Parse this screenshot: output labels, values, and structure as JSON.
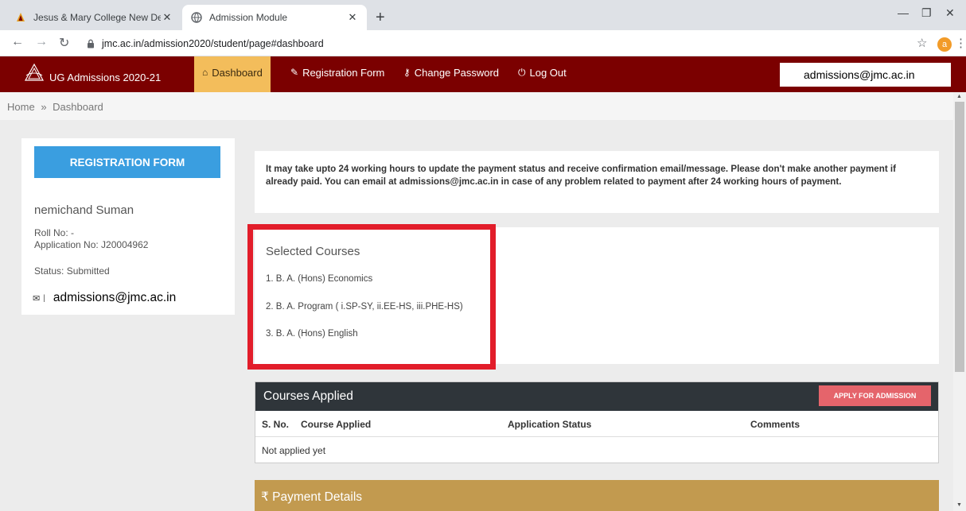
{
  "browser": {
    "tabs": [
      {
        "title": "Jesus & Mary College New Delhi",
        "active": false
      },
      {
        "title": "Admission Module",
        "active": true
      }
    ],
    "new_tab": "+",
    "url": "jmc.ac.in/admission2020/student/page#dashboard",
    "profile_initial": "a"
  },
  "header": {
    "brand": "UG Admissions 2020-21",
    "nav": [
      {
        "label": "Dashboard",
        "icon": "home-icon",
        "glyph": "⌂",
        "active": true
      },
      {
        "label": "Registration Form",
        "icon": "edit-icon",
        "glyph": "✎",
        "active": false
      },
      {
        "label": "Change Password",
        "icon": "key-icon",
        "glyph": "⚷",
        "active": false
      },
      {
        "label": "Log Out",
        "icon": "power-icon",
        "glyph": "⏻",
        "active": false
      }
    ],
    "email_overlay": "admissions@jmc.ac.in"
  },
  "breadcrumb": {
    "home": "Home",
    "sep": "»",
    "current": "Dashboard"
  },
  "sidebar": {
    "button": "REGISTRATION FORM",
    "name": "nemichand Suman",
    "roll": "Roll No: -",
    "application": "Application No: J20004962",
    "status": "Status: Submitted",
    "email": "admissions@jmc.ac.in"
  },
  "notice": "It may take upto 24 working hours to update the payment status and receive confirmation email/message. Please don't make another payment if already paid. You can email at admissions@jmc.ac.in in case of any problem related to payment after 24 working hours of payment.",
  "selected_courses": {
    "title": "Selected Courses",
    "items": [
      "1. B. A. (Hons) Economics",
      "2. B. A. Program ( i.SP-SY, ii.EE-HS, iii.PHE-HS)",
      "3. B. A. (Hons) English"
    ]
  },
  "courses_applied": {
    "title": "Courses Applied",
    "apply_button": "APPLY FOR ADMISSION",
    "columns": [
      "S. No.",
      "Course Applied",
      "Application Status",
      "Comments"
    ],
    "empty": "Not applied yet"
  },
  "payment": {
    "title": "₹ Payment Details"
  },
  "colors": {
    "header": "#7b0000",
    "active_nav": "#f3bd5b",
    "primary_button": "#3a9ee0",
    "apply_button": "#e5646b",
    "highlight": "#e21d2a",
    "payment_bar": "#c29a4f"
  }
}
